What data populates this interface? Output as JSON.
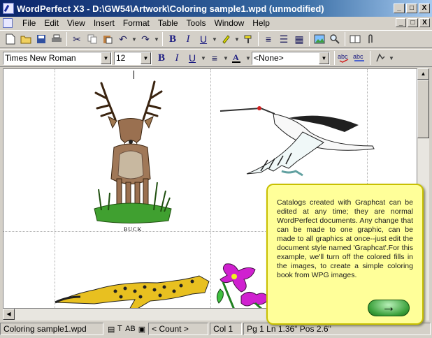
{
  "window": {
    "title": "WordPerfect X3 - D:\\GW54\\Artwork\\Coloring sample1.wpd (unmodified)",
    "minimize": "_",
    "maximize": "□",
    "close": "X"
  },
  "menubar": {
    "items": [
      "File",
      "Edit",
      "View",
      "Insert",
      "Format",
      "Table",
      "Tools",
      "Window",
      "Help"
    ]
  },
  "property_bar": {
    "font_name": "Times New Roman",
    "font_size": "12",
    "bold": "B",
    "italic": "I",
    "underline": "U",
    "style": "<None>"
  },
  "document": {
    "caption": "BUCK",
    "images": [
      "buck",
      "crane",
      "cheetah",
      "flowers"
    ]
  },
  "balloon": {
    "text": "Catalogs created with Graphcat can be edited at any time; they are normal WordPerfect documents.  Any change that can be made to one graphic, can be made to all graphics at once--just edit the document style named 'Graphcat'.For this example, we'll turn off the colored fills in the images, to create a simple coloring book from WPG images.",
    "next": "→"
  },
  "statusbar": {
    "filename": "Coloring sample1.wpd",
    "count": "< Count >",
    "column": "Col 1",
    "position": "Pg 1 Ln 1.36\" Pos 2.6\""
  },
  "colors": {
    "title_gradient_start": "#0a246a",
    "balloon_bg": "#ffff99",
    "button_green": "#3aa03a"
  }
}
